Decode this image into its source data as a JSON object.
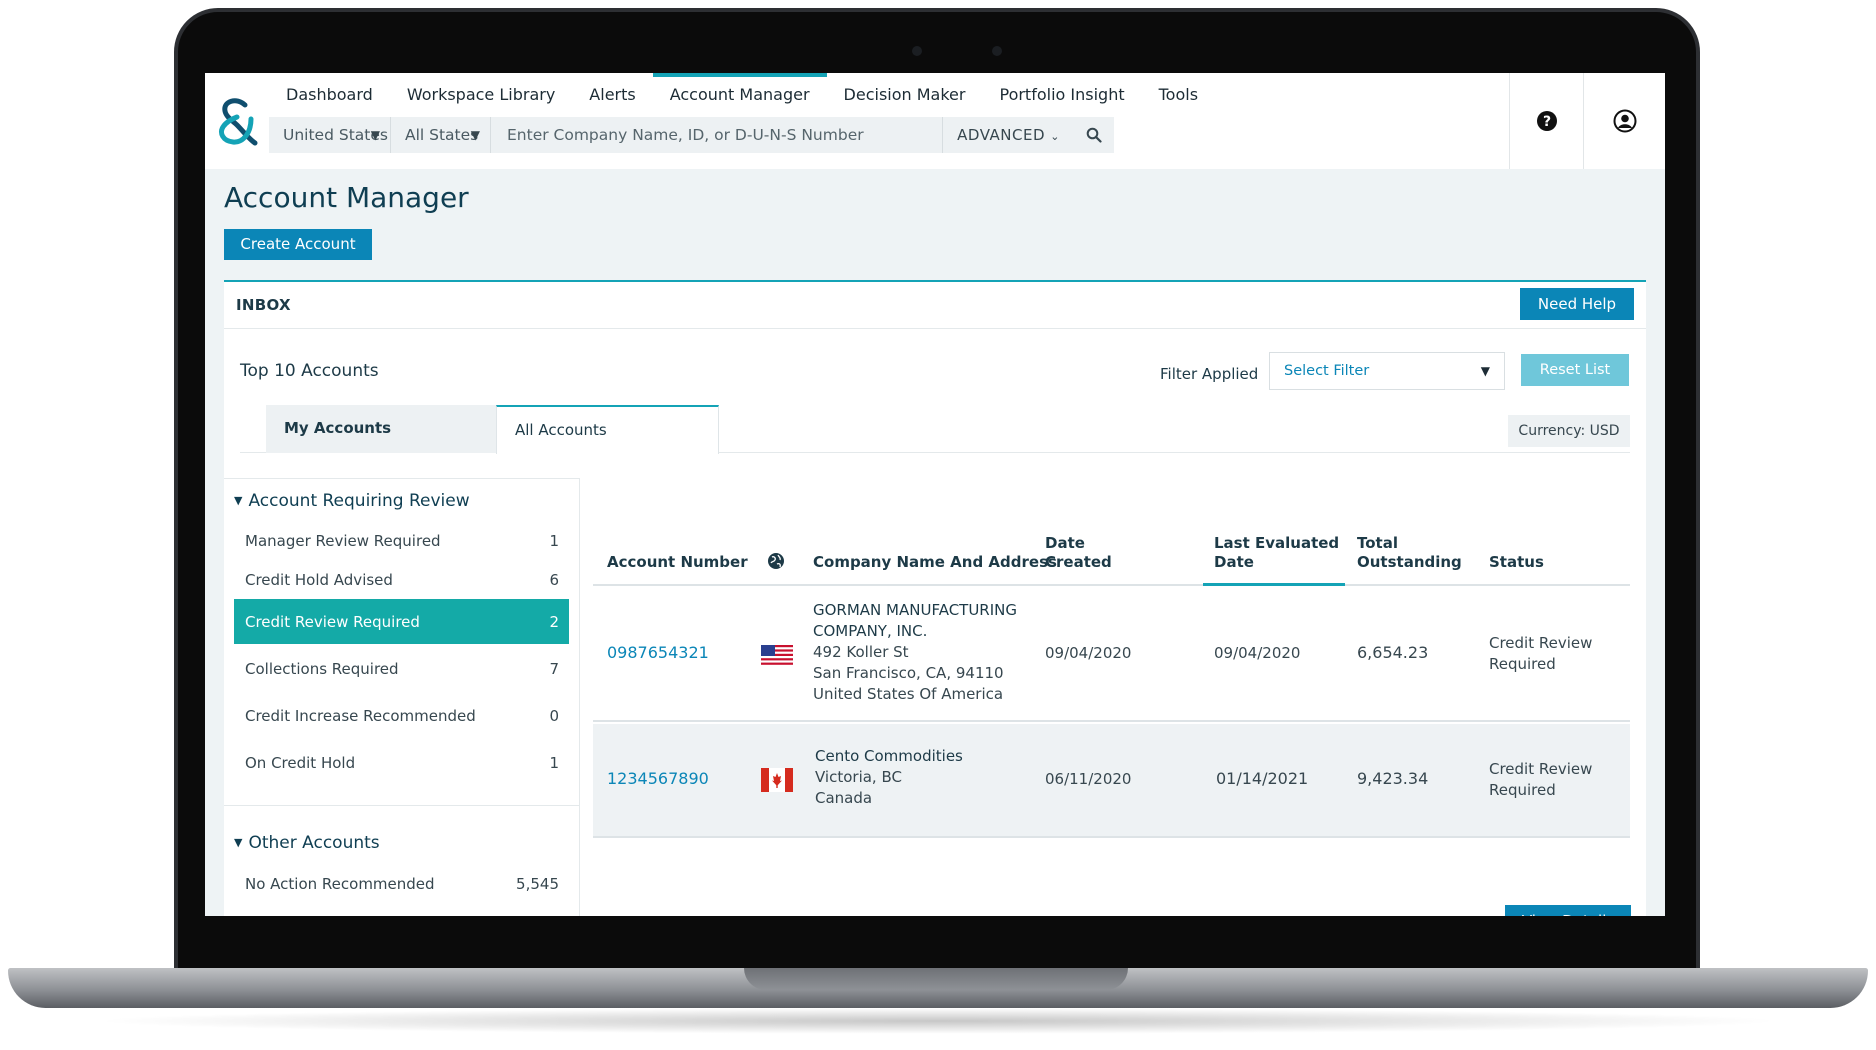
{
  "nav": {
    "items": [
      "Dashboard",
      "Workspace Library",
      "Alerts",
      "Account Manager",
      "Decision Maker",
      "Portfolio Insight",
      "Tools"
    ],
    "active_index": 3
  },
  "search": {
    "country": "United States",
    "state": "All States",
    "placeholder": "Enter Company Name, ID, or D-U-N-S Number",
    "advanced_label": "ADVANCED"
  },
  "icons": {
    "logo": "dnb-ampersand-logo",
    "help": "question-circle-icon",
    "user": "user-avatar-icon",
    "search": "search-icon",
    "globe": "globe-icon"
  },
  "page": {
    "title": "Account Manager",
    "create_label": "Create Account"
  },
  "inbox": {
    "label": "INBOX",
    "help_label": "Need Help",
    "top_label": "Top 10 Accounts",
    "filter_label": "Filter Applied",
    "filter_placeholder": "Select Filter",
    "reset_label": "Reset List",
    "currency_label": "Currency:",
    "currency_value": "USD"
  },
  "tabs": {
    "my": "My Accounts",
    "all": "All Accounts"
  },
  "sidebar": {
    "review_group": {
      "title": "Account Requiring Review",
      "items": [
        {
          "label": "Manager Review Required",
          "count": "1"
        },
        {
          "label": "Credit Hold Advised",
          "count": "6"
        },
        {
          "label": "Credit Review Required",
          "count": "2"
        },
        {
          "label": "Collections Required",
          "count": "7"
        },
        {
          "label": "Credit Increase Recommended",
          "count": "0"
        },
        {
          "label": "On Credit Hold",
          "count": "1"
        }
      ],
      "active_index": 2
    },
    "other_group": {
      "title": "Other Accounts",
      "items": [
        {
          "label": "No Action Recommended",
          "count": "5,545"
        }
      ]
    }
  },
  "table": {
    "columns": {
      "account": "Account Number",
      "company": "Company Name And Address",
      "date_created_1": "Date",
      "date_created_2": "Created",
      "last_eval_1": "Last Evaluated",
      "last_eval_2": "Date",
      "total_1": "Total",
      "total_2": "Outstanding",
      "status": "Status"
    },
    "rows": [
      {
        "account": "0987654321",
        "flag": "us-flag",
        "company_line1": "GORMAN MANUFACTURING",
        "company_line2": "COMPANY, INC.",
        "address1": "492 Koller St",
        "address2": "San Francisco, CA, 94110",
        "address3": "United States Of America",
        "date_created": "09/04/2020",
        "last_evaluated": "09/04/2020",
        "total": "6,654.23",
        "status_1": "Credit Review",
        "status_2": "Required"
      },
      {
        "account": "1234567890",
        "flag": "canada-flag",
        "company_line1": "Cento Commodities",
        "address1": "Victoria, BC",
        "address2": "Canada",
        "date_created": "06/11/2020",
        "last_evaluated": "01/14/2021",
        "total": "9,423.34",
        "status_1": "Credit Review",
        "status_2": "Required"
      }
    ],
    "view_label": "View Details"
  },
  "colors": {
    "accent": "#14a3b6",
    "primary_button": "#0b86b7",
    "active_item": "#14aaa7",
    "title": "#0f3e52"
  }
}
